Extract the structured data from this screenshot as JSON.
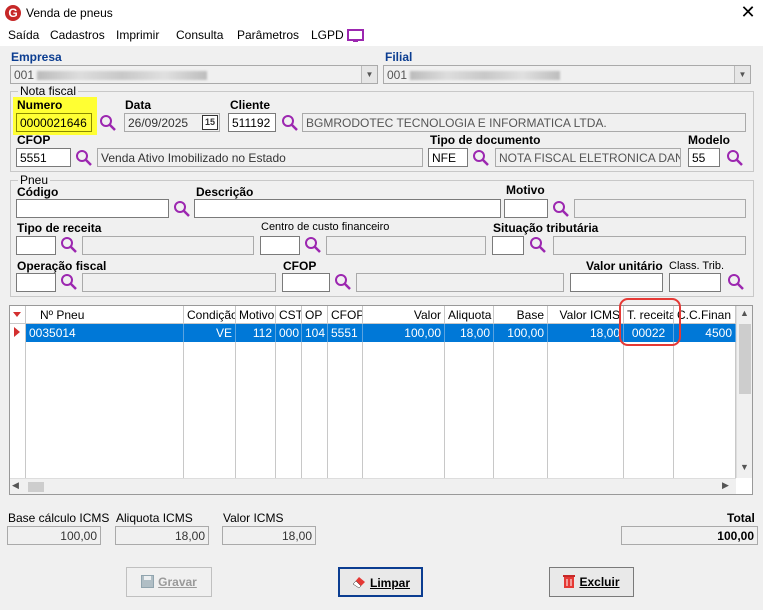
{
  "window": {
    "title": "Venda de pneus"
  },
  "menu": [
    "Saída",
    "Cadastros",
    "Imprimir",
    "Consulta",
    "Parâmetros",
    "LGPD"
  ],
  "empresa": {
    "label": "Empresa",
    "value": "001"
  },
  "filial": {
    "label": "Filial",
    "value": "001"
  },
  "nota": {
    "group": "Nota fiscal",
    "numero_label": "Numero",
    "numero": "0000021646",
    "data_label": "Data",
    "data": "26/09/2025",
    "calendar_num": "15",
    "cliente_label": "Cliente",
    "cliente_code": "511192",
    "cliente_name": "BGMRODOTEC TECNOLOGIA E INFORMATICA LTDA.",
    "cfop_label": "CFOP",
    "cfop": "5551",
    "cfop_desc": "Venda Ativo Imobilizado no Estado",
    "tipo_doc_label": "Tipo de documento",
    "tipo_doc": "NFE",
    "tipo_doc_desc": "NOTA FISCAL ELETRONICA DANFE",
    "modelo_label": "Modelo",
    "modelo": "55"
  },
  "pneu": {
    "group": "Pneu",
    "codigo_label": "Código",
    "descricao_label": "Descrição",
    "motivo_label": "Motivo",
    "tipo_receita_label": "Tipo de receita",
    "centro_custo_label": "Centro de custo financeiro",
    "situacao_label": "Situação tributária",
    "operacao_label": "Operação fiscal",
    "cfop_label": "CFOP",
    "valor_unit_label": "Valor unitário",
    "class_trib_label": "Class. Trib."
  },
  "table": {
    "headers": [
      "Nº Pneu",
      "Condição",
      "Motivo",
      "CST",
      "OP",
      "CFOP",
      "Valor",
      "Aliquota",
      "Base",
      "Valor ICMS",
      "T. receita",
      "C.C.Finan"
    ],
    "rows": [
      [
        "0035014",
        "VE",
        "112",
        "000",
        "104",
        "5551",
        "100,00",
        "18,00",
        "100,00",
        "18,00",
        "00022",
        "4500"
      ]
    ]
  },
  "totals": {
    "base_label": "Base cálculo ICMS",
    "base": "100,00",
    "aliquota_label": "Aliquota ICMS",
    "aliquota": "18,00",
    "valor_icms_label": "Valor ICMS",
    "valor_icms": "18,00",
    "total_label": "Total",
    "total": "100,00"
  },
  "buttons": {
    "gravar": "Gravar",
    "limpar": "Limpar",
    "excluir": "Excluir"
  },
  "colors": {
    "accent": "#0078d7",
    "highlight": "#ffff33",
    "annotation": "#e53935",
    "magnifier": "#9c27b0"
  }
}
